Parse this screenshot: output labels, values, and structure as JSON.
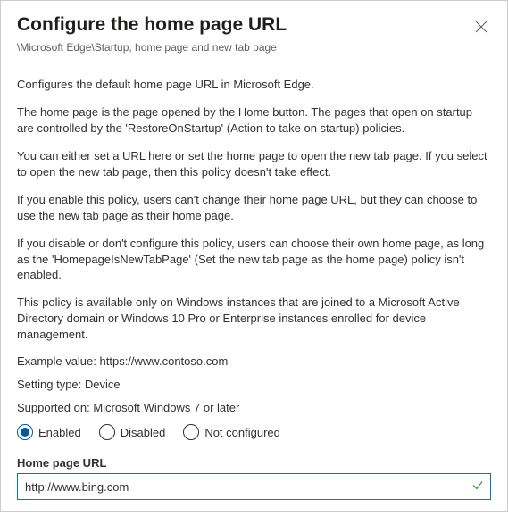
{
  "header": {
    "title": "Configure the home page URL",
    "breadcrumb": "\\Microsoft Edge\\Startup, home page and new tab page"
  },
  "paragraphs": [
    "Configures the default home page URL in Microsoft Edge.",
    "The home page is the page opened by the Home button. The pages that open on startup are controlled by the 'RestoreOnStartup' (Action to take on startup) policies.",
    "You can either set a URL here or set the home page to open the new tab page. If you select to open the new tab page, then this policy doesn't take effect.",
    "If you enable this policy, users can't change their home page URL, but they can choose to use the new tab page as their home page.",
    "If you disable or don't configure this policy, users can choose their own home page, as long as the 'HomepageIsNewTabPage' (Set the new tab page as the home page) policy isn't enabled.",
    "This policy is available only on Windows instances that are joined to a Microsoft Active Directory domain or Windows 10 Pro or Enterprise instances enrolled for device management."
  ],
  "example": {
    "label": "Example value:",
    "value": "https://www.contoso.com"
  },
  "setting_type": {
    "label": "Setting type:",
    "value": "Device"
  },
  "supported": {
    "label": "Supported on:",
    "value": "Microsoft Windows 7 or later"
  },
  "state": {
    "options": [
      "Enabled",
      "Disabled",
      "Not configured"
    ],
    "selected": "Enabled"
  },
  "field": {
    "label": "Home page URL",
    "value": "http://www.bing.com"
  }
}
